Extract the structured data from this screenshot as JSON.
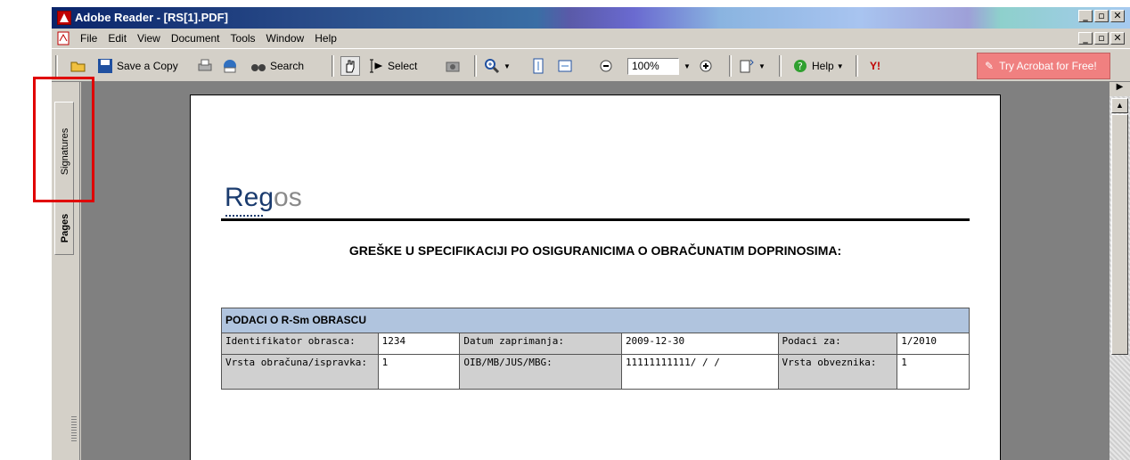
{
  "window": {
    "title": "Adobe Reader - [RS[1].PDF]",
    "buttons": [
      "_",
      "ř",
      "×"
    ]
  },
  "menu": {
    "items": [
      "File",
      "Edit",
      "View",
      "Document",
      "Tools",
      "Window",
      "Help"
    ]
  },
  "toolbar": {
    "save_copy": "Save a Copy",
    "search": "Search",
    "select": "Select",
    "zoom": "100%",
    "help": "Help",
    "acrobat": "Try Acrobat for Free!"
  },
  "sidebar": {
    "tabs": [
      "Signatures",
      "Pages"
    ]
  },
  "document": {
    "logo_main": "Reg",
    "logo_os": "os",
    "heading": "GREŠKE U SPECIFIKACIJI PO OSIGURANICIMA O OBRAČUNATIM DOPRINOSIMA:",
    "form_title": "PODACI O R-Sm OBRASCU",
    "rows": [
      [
        "Identifikator obrasca:",
        "1234",
        "Datum zaprimanja:",
        "2009-12-30",
        "Podaci za:",
        "1/2010"
      ],
      [
        "Vrsta obračuna/ispravka:",
        "1",
        "OIB/MB/JUS/MBG:",
        "11111111111/ / /",
        "Vrsta obveznika:",
        "1"
      ]
    ]
  },
  "colors": {
    "highlight": "#e00000",
    "form_header": "#b0c4de",
    "logo": "#1a3b6e"
  }
}
